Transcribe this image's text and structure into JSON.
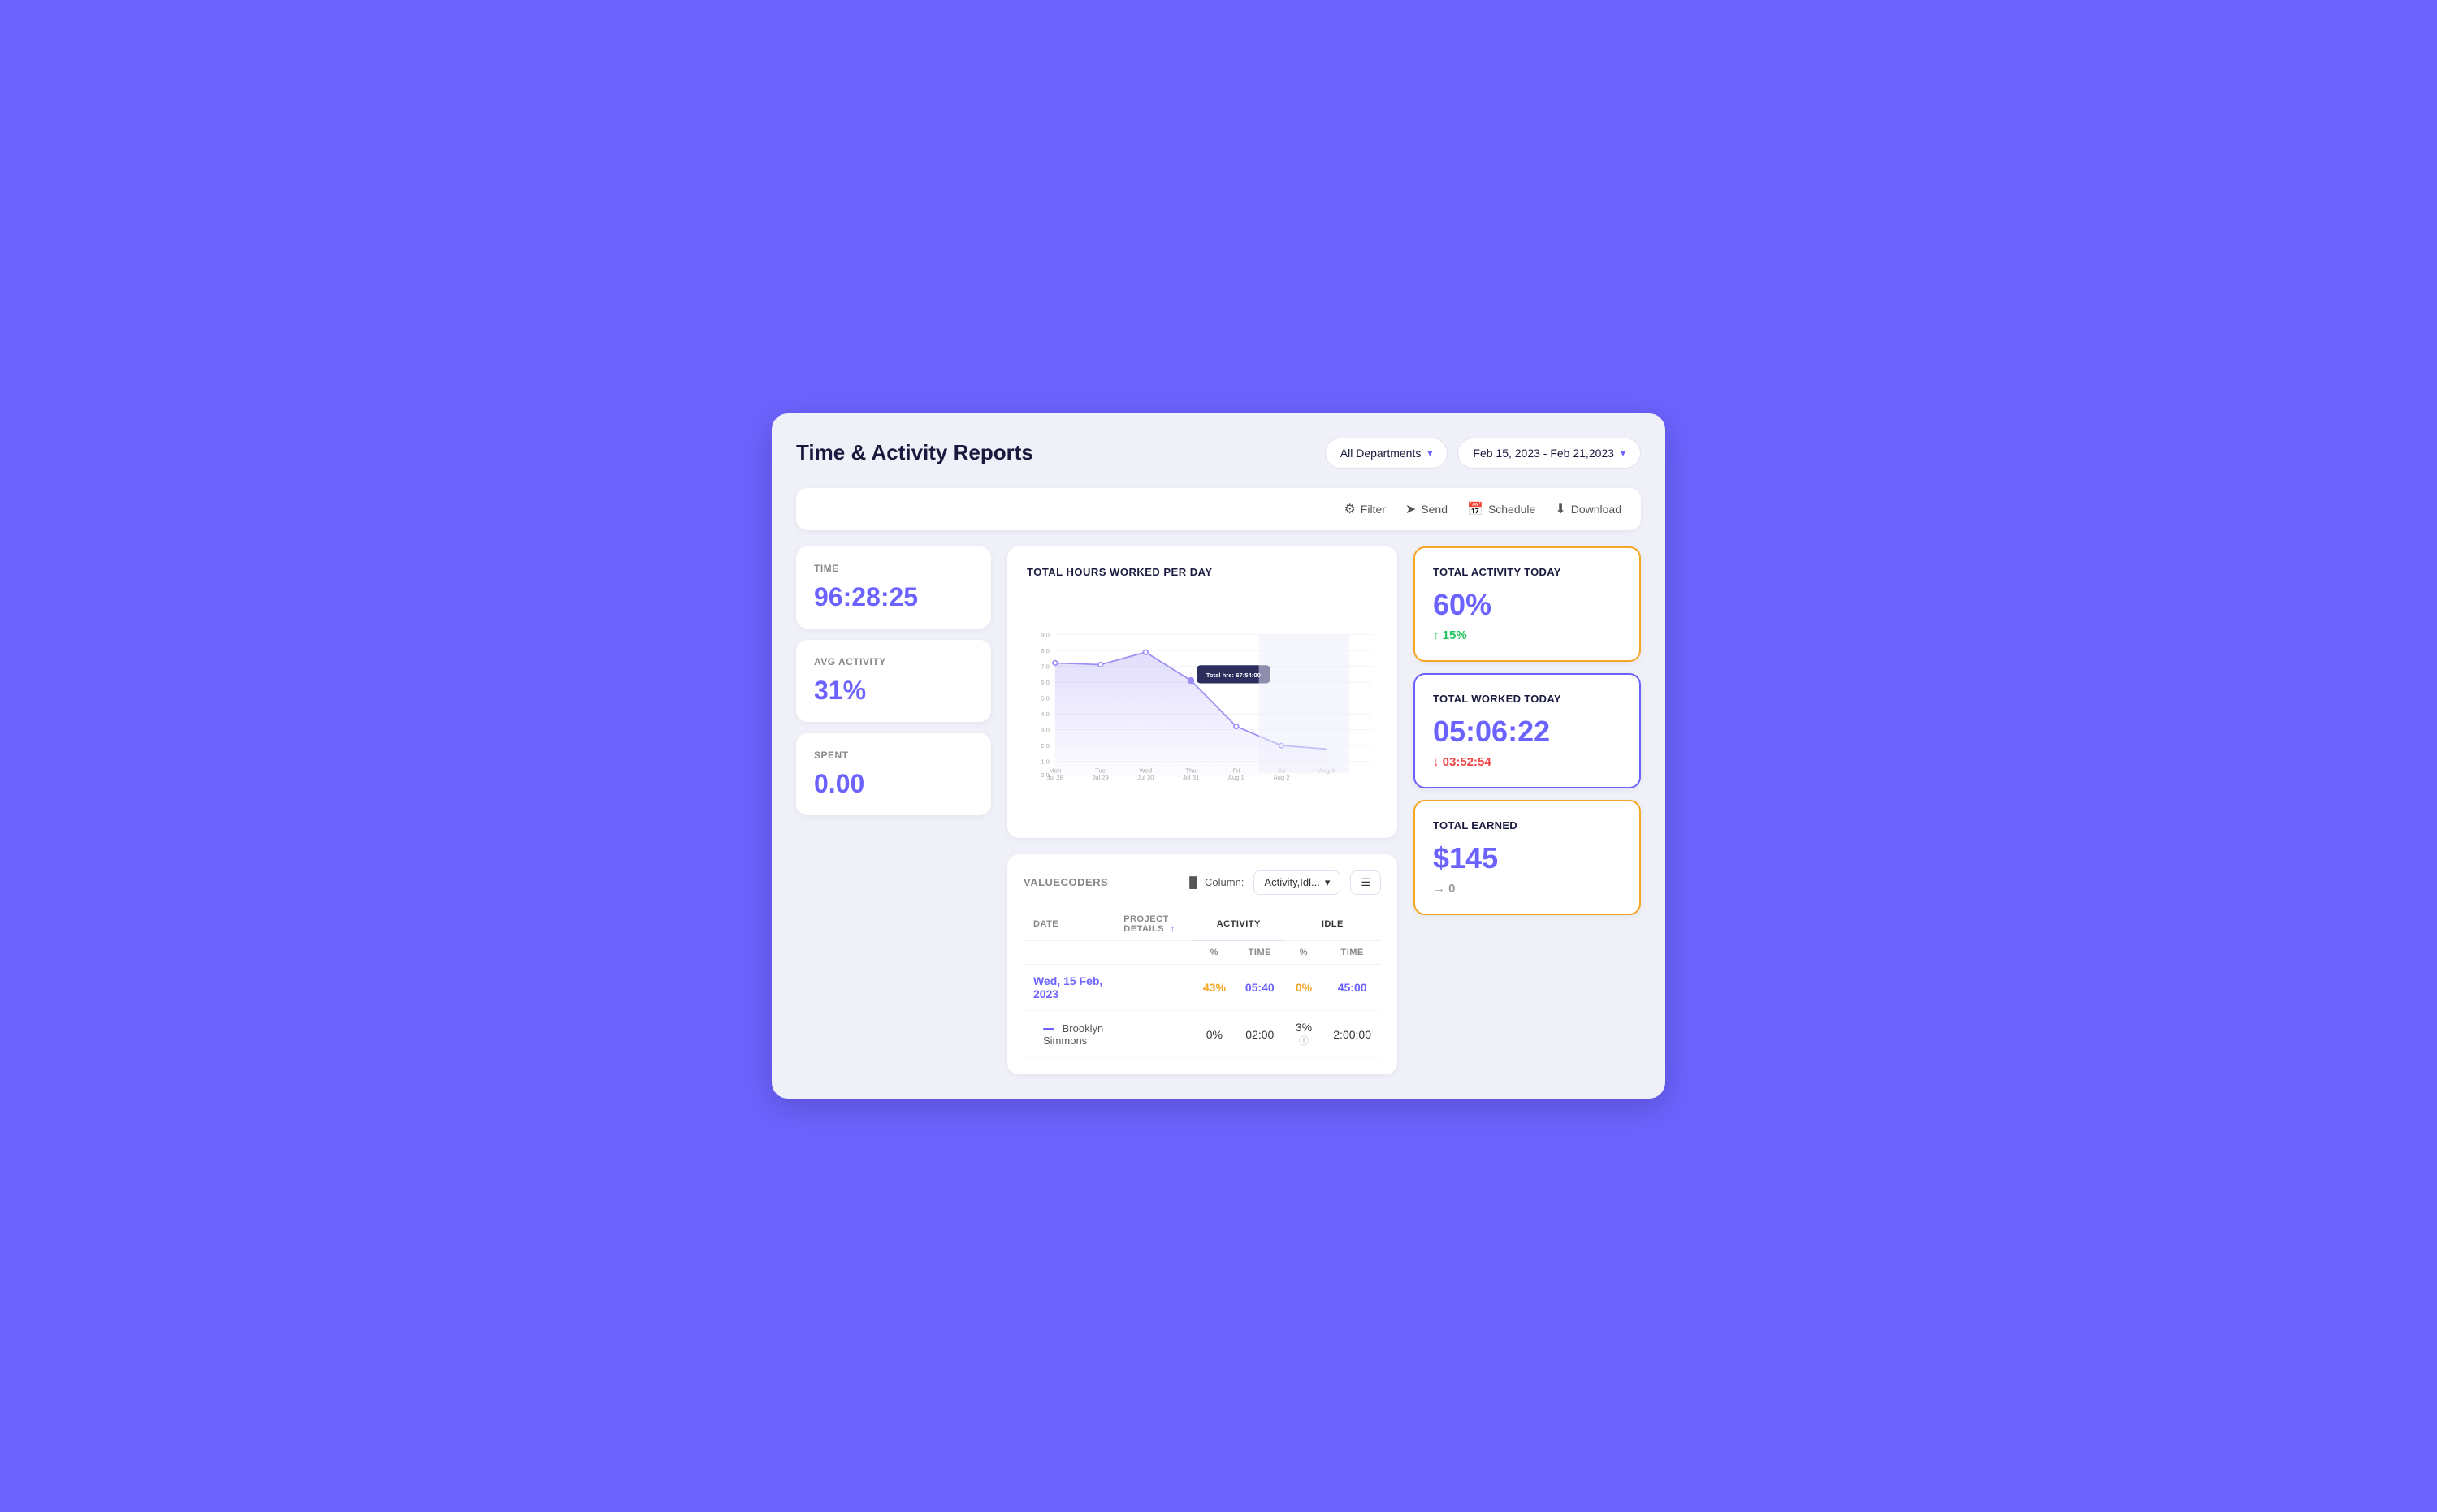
{
  "page": {
    "title": "Time & Activity Reports"
  },
  "header": {
    "department_selector": "All Departments",
    "date_range": "Feb 15, 2023 - Feb 21,2023"
  },
  "toolbar": {
    "filter_label": "Filter",
    "send_label": "Send",
    "schedule_label": "Schedule",
    "download_label": "Download"
  },
  "stats": {
    "time_label": "TIME",
    "time_value": "96:28:25",
    "avg_activity_label": "AVG ACTIVITY",
    "avg_activity_value": "31%",
    "spent_label": "SPENT",
    "spent_value": "0.00"
  },
  "chart": {
    "title": "TOTAL HOURS WORKED PER DAY",
    "tooltip": "Total hrs: 67:54:00",
    "x_labels": [
      "Mon\nJul 28",
      "Tue\nJul 29",
      "Wed\nJul 30",
      "Thu\nJul 31",
      "Fri\nAug 1",
      "Sa\nAug 2",
      "Aug 3"
    ],
    "y_labels": [
      "0.0",
      "1.0",
      "2.0",
      "3.0",
      "4.0",
      "5.0",
      "6.0",
      "7.0",
      "8.0",
      "9.0"
    ],
    "data_points": [
      {
        "day": "Mon Jul 28",
        "value": 7.2
      },
      {
        "day": "Tue Jul 29",
        "value": 7.1
      },
      {
        "day": "Wed Jul 30",
        "value": 7.9
      },
      {
        "day": "Thu Jul 31",
        "value": 6.1
      },
      {
        "day": "Fri Aug 1",
        "value": 3.2
      },
      {
        "day": "Sat Aug 2",
        "value": 2.0
      },
      {
        "day": "Aug 3",
        "value": 1.8
      }
    ]
  },
  "summary_cards": {
    "activity": {
      "title": "TOTAL ACTIVITY TODAY",
      "value": "60%",
      "change": "↑ 15%",
      "change_type": "up"
    },
    "worked": {
      "title": "TOTAL WORKED TODAY",
      "value": "05:06:22",
      "change": "↓ 03:52:54",
      "change_type": "down"
    },
    "earned": {
      "title": "TOTAL EARNED",
      "value": "$145",
      "change": "→ 0",
      "change_type": "neutral"
    }
  },
  "table": {
    "org_name": "VALUECODERS",
    "column_selector": "Activity,Idl...",
    "columns": {
      "date": "DATE",
      "project_details": "PROJECT DETAILS",
      "activity_pct": "%",
      "activity_time": "TIME",
      "idle_pct": "%",
      "idle_time": "TIME"
    },
    "col_groups": {
      "activity": "ACTIVITY",
      "idle": "IDLE"
    },
    "rows": [
      {
        "type": "date",
        "date": "Wed, 15 Feb, 2023",
        "project_details": "",
        "activity_pct": "43%",
        "activity_time": "05:40",
        "idle_pct": "0%",
        "idle_time": "45:00"
      },
      {
        "type": "sub",
        "date": "",
        "name": "Brooklyn Simmons",
        "project_details": "",
        "activity_pct": "0%",
        "activity_time": "02:00",
        "idle_pct": "3%",
        "idle_time": "2:00:00"
      }
    ]
  }
}
